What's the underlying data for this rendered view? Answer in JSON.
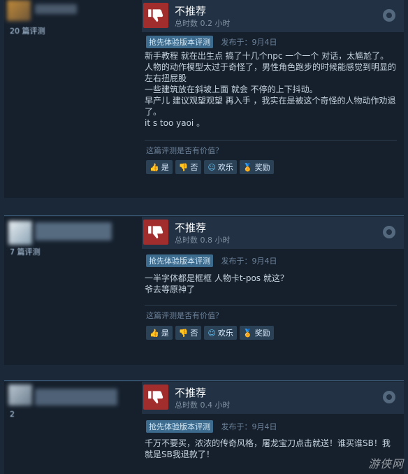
{
  "reviews": [
    {
      "count_label": "20 篇评测",
      "verdict": "不推荐",
      "hours": "总时数 0.2 小时",
      "ea_badge": "抢先体验版本评测",
      "posted": "发布于：9月4日",
      "body": "新手教程 就在出生点 搞了十几个npc 一个一个 对话，太尴尬了。\n人物的动作模型太过于奇怪了，男性角色跑步的时候能感觉到明显的左右扭屁股\n一些建筑放在斜坡上面 就会 不停的上下抖动。\n早产儿 建议观望观望 再入手 ，我实在是被这个奇怪的人物动作劝退了。\nit s too yaoi 。",
      "helpful_q": "这篇评测是否有价值？",
      "yes": "是",
      "no": "否",
      "funny": "欢乐",
      "award": "奖励"
    },
    {
      "count_label": "7 篇评测",
      "verdict": "不推荐",
      "hours": "总时数 0.8 小时",
      "ea_badge": "抢先体验版本评测",
      "posted": "发布于：9月4日",
      "body": "一半字体都是框框 人物卡t-pos 就这？\n爷去等原神了",
      "helpful_q": "这篇评测是否有价值？",
      "yes": "是",
      "no": "否",
      "funny": "欢乐",
      "award": "奖励"
    },
    {
      "count_label": "2",
      "verdict": "不推荐",
      "hours": "总时数 0.4 小时",
      "ea_badge": "抢先体验版本评测",
      "posted": "发布于：9月4日",
      "body": "千万不要买，浓浓的传奇风格，屠龙宝刀点击就送！谁买谁SB！我就是SB我退款了！"
    }
  ],
  "watermark": "游侠网",
  "colors": {
    "thumb_bg": "#a22d2d",
    "badge_bg": "#3d6b8e",
    "link": "#67c1f5"
  }
}
